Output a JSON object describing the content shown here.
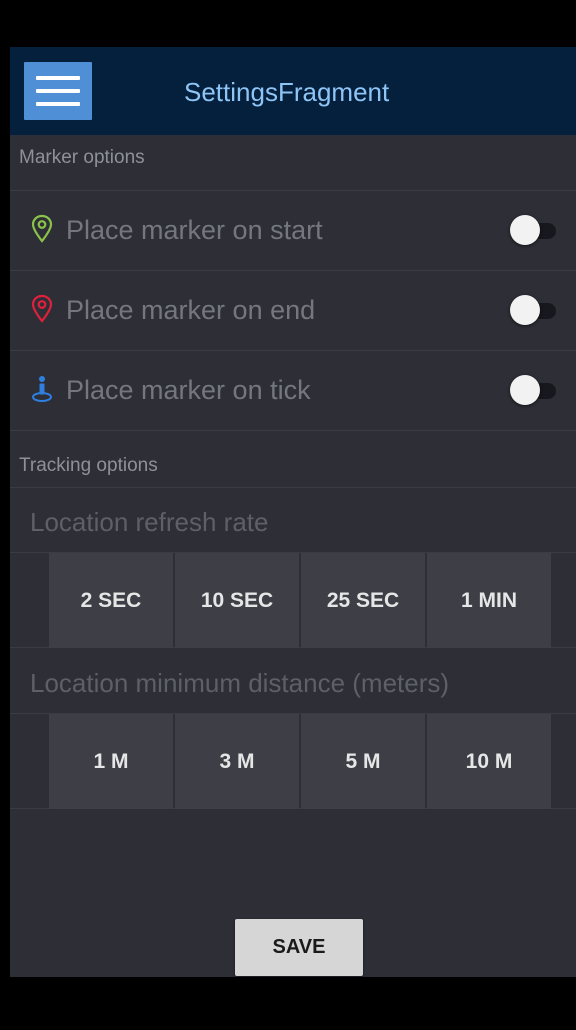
{
  "app_bar": {
    "title": "SettingsFragment",
    "menu_icon": "hamburger-menu-icon"
  },
  "marker_section": {
    "header": "Marker options",
    "items": [
      {
        "label": "Place marker on start",
        "icon": "map-pin-outline-icon",
        "icon_color": "#8bc34a",
        "enabled": false
      },
      {
        "label": "Place marker on end",
        "icon": "map-pin-outline-icon",
        "icon_color": "#e0203c",
        "enabled": false
      },
      {
        "label": "Place marker on tick",
        "icon": "person-pin-icon",
        "icon_color": "#2f7fe0",
        "enabled": false
      }
    ]
  },
  "tracking_section": {
    "header": "Tracking options",
    "refresh_rate": {
      "label": "Location refresh rate",
      "options": [
        "2 SEC",
        "10 SEC",
        "25 SEC",
        "1 MIN"
      ]
    },
    "min_distance": {
      "label": "Location minimum distance (meters)",
      "options": [
        "1 M",
        "3 M",
        "5 M",
        "10 M"
      ]
    }
  },
  "save_label": "SAVE",
  "colors": {
    "app_bar": "#05203c",
    "menu_button": "#4f8fd6",
    "title": "#8ec5f7",
    "background": "#2d2e36",
    "segment": "#3d3e46"
  }
}
